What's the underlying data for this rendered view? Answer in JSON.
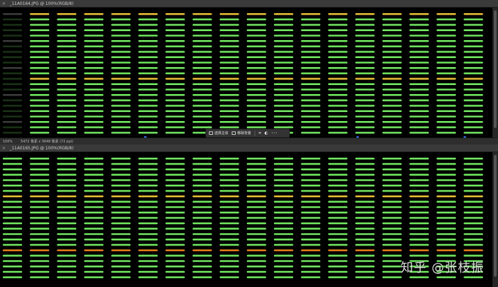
{
  "top_doc": {
    "tab_title": "_11A0164.JPG @ 100%(RGB/8)",
    "close_glyph": "×"
  },
  "bottom_doc": {
    "tab_title": "_11A0165.JPG @ 100%(RGB/8)",
    "close_glyph": "×"
  },
  "status_bar": {
    "zoom": "100%",
    "dimensions": "5472 像素 x 3648 像素 (72 ppi)"
  },
  "context_bar": {
    "select_subject": "选择主体",
    "remove_background": "移除背景",
    "more": "···"
  },
  "watermark": "知乎 @张枝振",
  "colors": {
    "led_green": "#7dff6a",
    "led_yellow": "#ffd23a",
    "led_orange": "#ff8a1e",
    "canvas_bg": "#000000"
  },
  "icons": [
    "close-icon",
    "select-subject-icon",
    "remove-background-icon",
    "crop-icon",
    "mask-icon",
    "more-icon"
  ]
}
